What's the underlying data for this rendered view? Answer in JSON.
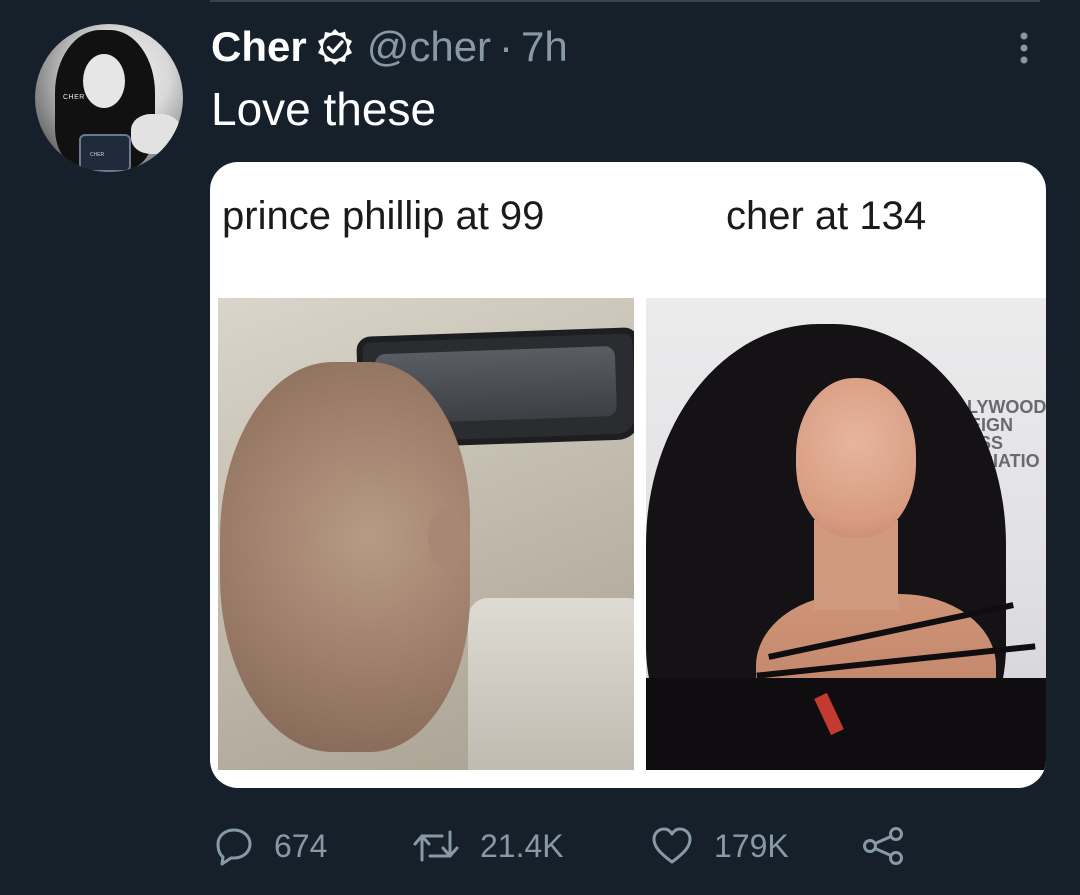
{
  "tweet": {
    "author_name": "Cher",
    "handle": "@cher",
    "separator": "·",
    "time": "7h",
    "text": "Love these",
    "avatar_text": {
      "brand": "CHER",
      "bottle": "CHER"
    },
    "media": {
      "caption_left": "prince phillip at 99",
      "caption_right": "cher at 134",
      "backdrop_lines": [
        "OLLYWOOD",
        "OREIGN",
        "PRESS",
        "SSOCIATIO"
      ]
    },
    "actions": {
      "replies": "674",
      "retweets": "21.4K",
      "likes": "179K"
    }
  },
  "icons": {
    "verified": "verified-badge-icon",
    "more": "more-options-icon",
    "reply": "reply-icon",
    "retweet": "retweet-icon",
    "like": "heart-icon",
    "share": "share-icon"
  },
  "colors": {
    "background": "#15202b",
    "secondary_text": "#8899a6",
    "primary_text": "#ffffff"
  }
}
